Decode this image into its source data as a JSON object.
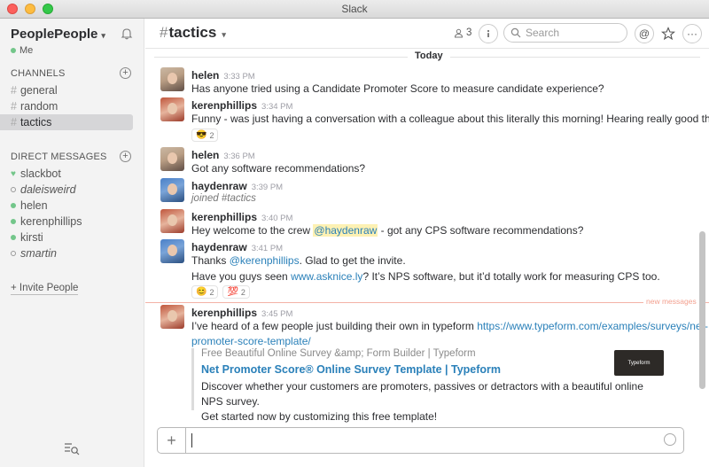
{
  "window": {
    "title": "Slack"
  },
  "sidebar": {
    "team_name": "PeoplePeople",
    "user_status": "Me",
    "channels_header": "CHANNELS",
    "channels": [
      {
        "name": "general"
      },
      {
        "name": "random"
      },
      {
        "name": "tactics",
        "active": true
      }
    ],
    "dm_header": "DIRECT MESSAGES",
    "direct_messages": [
      {
        "name": "slackbot",
        "status": "bot"
      },
      {
        "name": "daleisweird",
        "status": "away"
      },
      {
        "name": "helen",
        "status": "online"
      },
      {
        "name": "kerenphillips",
        "status": "online"
      },
      {
        "name": "kirsti",
        "status": "online"
      },
      {
        "name": "smartin",
        "status": "away"
      }
    ],
    "invite_label": "+ Invite People"
  },
  "header": {
    "channel": "tactics",
    "member_count": "3",
    "search_placeholder": "Search"
  },
  "messages": {
    "day_divider": "Today",
    "new_messages_label": "new messages",
    "m1": {
      "author": "helen",
      "time": "3:33 PM",
      "text": "Has anyone tried using a Candidate Promoter Score to measure candidate experience?"
    },
    "m2": {
      "author": "kerenphillips",
      "time": "3:34 PM",
      "text": "Funny - was just having a conversation with a colleague about this literally this morning! Hearing really good things.",
      "reaction_count": "2"
    },
    "m3": {
      "author": "helen",
      "time": "3:36 PM",
      "text": "Got any software recommendations?"
    },
    "m4": {
      "author": "haydenraw",
      "time": "3:39 PM",
      "text": "joined #tactics"
    },
    "m5": {
      "author": "kerenphillips",
      "time": "3:40 PM",
      "pre": "Hey welcome to the crew ",
      "mention": "@haydenraw",
      "post": " - got any CPS software recommendations?"
    },
    "m6": {
      "author": "haydenraw",
      "time": "3:41 PM",
      "l1_pre": "Thanks ",
      "l1_mention": "@kerenphillips",
      "l1_post": ". Glad to get the invite.",
      "l2_pre": "Have you guys seen ",
      "l2_link": "www.asknice.ly",
      "l2_post": "? It’s NPS software, but it’d totally work for measuring CPS too.",
      "reaction1_count": "2",
      "reaction2_count": "2"
    },
    "m7": {
      "author": "kerenphillips",
      "time": "3:45 PM",
      "pre": "I’ve heard of a few people just building their own in typeform ",
      "link_l1": "https://www.typeform.com/examples/surveys/net-",
      "link_l2": "promoter-score-template/"
    },
    "unfurl": {
      "source": "Free Beautiful Online Survey &amp; Form Builder | Typeform",
      "title": "Net Promoter Score® Online Survey Template | Typeform",
      "desc_l1": "Discover whether your customers are promoters, passives or detractors with a beautiful online NPS survey.",
      "desc_l2": "Get started now by customizing this free template!",
      "thumb_text": "Typeform"
    }
  },
  "composer": {
    "placeholder": ""
  },
  "colors": {
    "online": "#73c68a",
    "link": "#2a80b9",
    "new_messages": "#f3a08f",
    "active_channel_bg": "#d6d6d8"
  },
  "icons": [
    "bell-icon",
    "member-icon",
    "info-icon",
    "search-icon",
    "at-icon",
    "star-icon",
    "more-icon",
    "plus-icon",
    "emoji-icon"
  ]
}
